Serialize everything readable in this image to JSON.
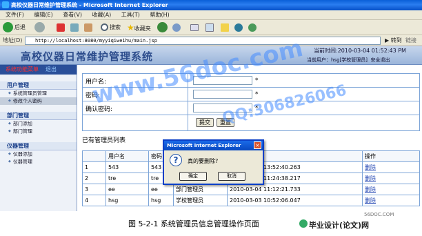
{
  "window": {
    "title": "高校仪器日常维护管理系统 - Microsoft Internet Explorer"
  },
  "menu": [
    "文件(F)",
    "编辑(E)",
    "查看(V)",
    "收藏(A)",
    "工具(T)",
    "帮助(H)"
  ],
  "toolbar": {
    "back": "后退",
    "search": "搜索",
    "favorites": "收藏夹"
  },
  "address": {
    "label": "地址(D)",
    "url": "http://localhost:8080/myyiqiweihu/main.jsp",
    "go": "转到",
    "links": "链接"
  },
  "banner": {
    "system_title": "高校仪器日常维护管理系统",
    "time": "当前时间:2010-03-04 01:52:43 PM",
    "user": "当前用户：hsg[学校管理员]",
    "logout": "安全退出"
  },
  "nav": {
    "header": "系统功能菜单",
    "exit": "退出",
    "groups": [
      {
        "title": "用户管理",
        "items": [
          "系统管理员管理",
          "修改个人密码"
        ]
      },
      {
        "title": "部门管理",
        "items": [
          "部门添加",
          "部门管理"
        ]
      },
      {
        "title": "仪器管理",
        "items": [
          "仪器添加",
          "仪器管理"
        ]
      }
    ]
  },
  "form": {
    "username_label": "用户名:",
    "password_label": "密码:",
    "confirm_label": "确认密码:",
    "required": "*",
    "submit": "提交",
    "reset": "重置"
  },
  "list": {
    "title": "已有管理员列表",
    "headers": [
      "",
      "用户名",
      "密码",
      "",
      "",
      "操作"
    ],
    "rows": [
      [
        "1",
        "543",
        "543",
        "",
        "2010-03-04 13:52:40.263",
        "删除"
      ],
      [
        "2",
        "tre",
        "tre",
        "",
        "2010-03-04 11:24:38.217",
        "删除"
      ],
      [
        "3",
        "ee",
        "ee",
        "部门管理员",
        "2010-03-04 11:12:21.733",
        "删除"
      ],
      [
        "4",
        "hsg",
        "hsg",
        "学校管理员",
        "2010-03-03 10:52:06.047",
        "删除"
      ]
    ]
  },
  "dialog": {
    "title": "Microsoft Internet Explorer",
    "message": "真的要删除?",
    "ok": "确定",
    "cancel": "取消"
  },
  "watermark": {
    "line1": "www.56doc.com",
    "line2": "QQ:306826066"
  },
  "caption": {
    "text": "图 5-2-1 系统管理员信息管理操作页面",
    "brand": "毕业设计(论文)网",
    "site": "56DOC.COM"
  }
}
